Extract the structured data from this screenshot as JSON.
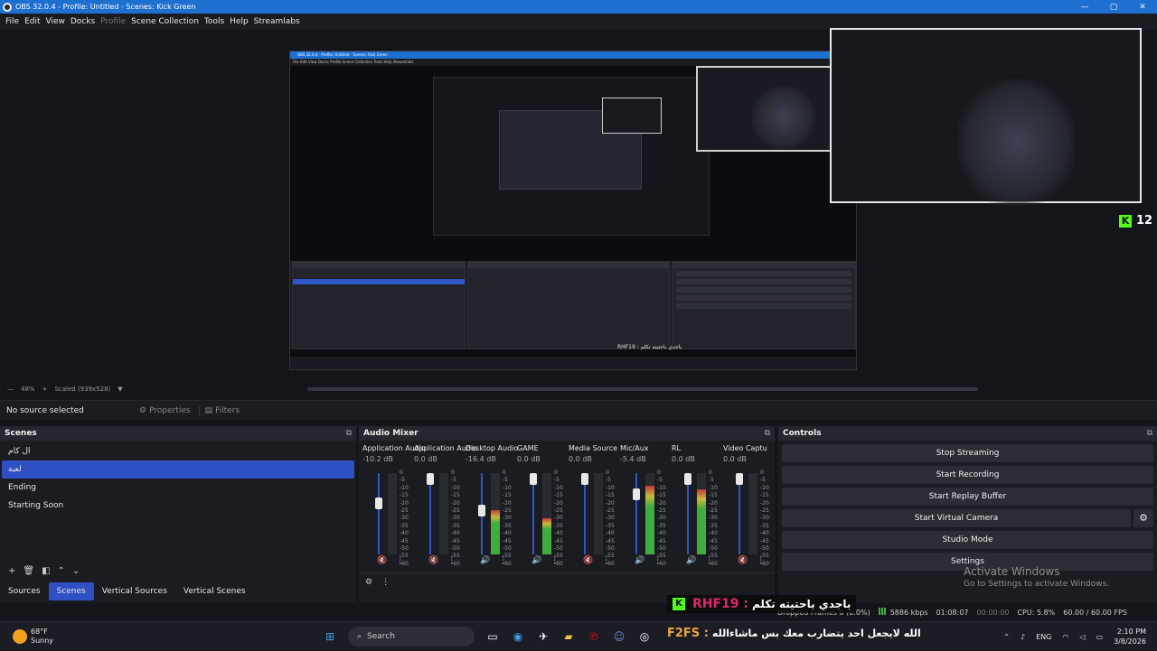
{
  "titlebar": {
    "title": "OBS 32.0.4 - Profile: Untitled - Scenes: Kick Green",
    "minimize": "—",
    "restore": "▢",
    "close": "✕"
  },
  "menu": [
    "File",
    "Edit",
    "View",
    "Docks",
    "Profile",
    "Scene Collection",
    "Tools",
    "Help",
    "Streamlabs"
  ],
  "nested_screen": {
    "title": "OBS 32.0.4 - Profile: Untitled - Scenes: Kick Green",
    "menu": "File  Edit  View  Docks  Profile  Scene Collection  Tools  Help  Streamlabs",
    "rhf_text": "RHF19 : باجدي باحتيته تكلم"
  },
  "kick": {
    "logo": "K",
    "viewers": "12"
  },
  "preview_status": {
    "zoom": "48%",
    "scaled": "Scaled (939x528)"
  },
  "source_bar": {
    "label": "No source selected",
    "properties": "Properties",
    "filters": "Filters"
  },
  "scenes": {
    "title": "Scenes",
    "items": [
      "ال كام",
      "لعبة",
      "Ending",
      "Starting Soon"
    ],
    "selected_index": 1,
    "tabs": [
      "Sources",
      "Scenes",
      "Vertical Sources",
      "Vertical Scenes"
    ],
    "active_tab": 1
  },
  "mixer": {
    "title": "Audio Mixer",
    "scale": [
      "0",
      "-5",
      "-10",
      "-15",
      "-20",
      "-25",
      "-30",
      "-35",
      "-40",
      "-45",
      "-50",
      "-55",
      "-60"
    ],
    "channels": [
      {
        "name": "Application Audio C",
        "db": "-10.2 dB",
        "level": 0.65,
        "meter": 0.0,
        "muted": true
      },
      {
        "name": "Application Audio C",
        "db": "0.0 dB",
        "level": 1.0,
        "meter": 0.0,
        "muted": true
      },
      {
        "name": "Desktop Audio",
        "db": "-16.4 dB",
        "level": 0.55,
        "meter": 0.55,
        "muted": false
      },
      {
        "name": "GAME",
        "db": "0.0 dB",
        "level": 1.0,
        "meter": 0.45,
        "muted": false
      },
      {
        "name": "Media Source",
        "db": "0.0 dB",
        "level": 1.0,
        "meter": 0.0,
        "muted": true
      },
      {
        "name": "Mic/Aux",
        "db": "-5.4 dB",
        "level": 0.78,
        "meter": 0.85,
        "muted": false
      },
      {
        "name": "RL",
        "db": "0.0 dB",
        "level": 1.0,
        "meter": 0.8,
        "muted": false
      },
      {
        "name": "Video Captu",
        "db": "0.0 dB",
        "level": 1.0,
        "meter": 0.0,
        "muted": true
      }
    ]
  },
  "controls": {
    "title": "Controls",
    "buttons": [
      "Stop Streaming",
      "Start Recording",
      "Start Replay Buffer",
      "Start Virtual Camera",
      "Studio Mode",
      "Settings"
    ]
  },
  "activate": {
    "line1": "Activate Windows",
    "line2": "Go to Settings to activate Windows."
  },
  "status": {
    "dropped": "Dropped Frames 0 (0.0%)",
    "bitrate": "5886 kbps",
    "live_time": "01:08:07",
    "rec_time": "00:00:00",
    "cpu": "CPU: 5.8%",
    "fps": "60.00 / 60.00 FPS"
  },
  "overlay": {
    "rhf_name": "RHF19 :",
    "rhf_msg": "باجدي باحتيته تكلم",
    "f2fs_name": "F2FS :",
    "f2fs_msg": "الله لايجعل احد يتضارب معك بس ماشاءالله"
  },
  "taskbar": {
    "weather_temp": "68°F",
    "weather_desc": "Sunny",
    "search": "Search",
    "lang": "ENG",
    "time": "2:10 PM",
    "date": "3/8/2026"
  }
}
